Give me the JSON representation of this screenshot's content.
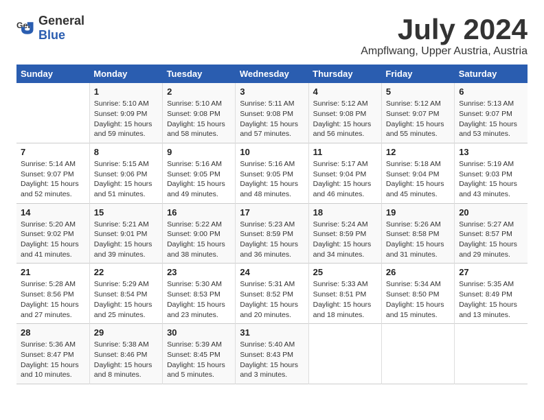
{
  "logo": {
    "general": "General",
    "blue": "Blue"
  },
  "title": "July 2024",
  "subtitle": "Ampflwang, Upper Austria, Austria",
  "weekdays": [
    "Sunday",
    "Monday",
    "Tuesday",
    "Wednesday",
    "Thursday",
    "Friday",
    "Saturday"
  ],
  "weeks": [
    [
      {
        "day": "",
        "info": ""
      },
      {
        "day": "1",
        "info": "Sunrise: 5:10 AM\nSunset: 9:09 PM\nDaylight: 15 hours\nand 59 minutes."
      },
      {
        "day": "2",
        "info": "Sunrise: 5:10 AM\nSunset: 9:08 PM\nDaylight: 15 hours\nand 58 minutes."
      },
      {
        "day": "3",
        "info": "Sunrise: 5:11 AM\nSunset: 9:08 PM\nDaylight: 15 hours\nand 57 minutes."
      },
      {
        "day": "4",
        "info": "Sunrise: 5:12 AM\nSunset: 9:08 PM\nDaylight: 15 hours\nand 56 minutes."
      },
      {
        "day": "5",
        "info": "Sunrise: 5:12 AM\nSunset: 9:07 PM\nDaylight: 15 hours\nand 55 minutes."
      },
      {
        "day": "6",
        "info": "Sunrise: 5:13 AM\nSunset: 9:07 PM\nDaylight: 15 hours\nand 53 minutes."
      }
    ],
    [
      {
        "day": "7",
        "info": "Sunrise: 5:14 AM\nSunset: 9:07 PM\nDaylight: 15 hours\nand 52 minutes."
      },
      {
        "day": "8",
        "info": "Sunrise: 5:15 AM\nSunset: 9:06 PM\nDaylight: 15 hours\nand 51 minutes."
      },
      {
        "day": "9",
        "info": "Sunrise: 5:16 AM\nSunset: 9:05 PM\nDaylight: 15 hours\nand 49 minutes."
      },
      {
        "day": "10",
        "info": "Sunrise: 5:16 AM\nSunset: 9:05 PM\nDaylight: 15 hours\nand 48 minutes."
      },
      {
        "day": "11",
        "info": "Sunrise: 5:17 AM\nSunset: 9:04 PM\nDaylight: 15 hours\nand 46 minutes."
      },
      {
        "day": "12",
        "info": "Sunrise: 5:18 AM\nSunset: 9:04 PM\nDaylight: 15 hours\nand 45 minutes."
      },
      {
        "day": "13",
        "info": "Sunrise: 5:19 AM\nSunset: 9:03 PM\nDaylight: 15 hours\nand 43 minutes."
      }
    ],
    [
      {
        "day": "14",
        "info": "Sunrise: 5:20 AM\nSunset: 9:02 PM\nDaylight: 15 hours\nand 41 minutes."
      },
      {
        "day": "15",
        "info": "Sunrise: 5:21 AM\nSunset: 9:01 PM\nDaylight: 15 hours\nand 39 minutes."
      },
      {
        "day": "16",
        "info": "Sunrise: 5:22 AM\nSunset: 9:00 PM\nDaylight: 15 hours\nand 38 minutes."
      },
      {
        "day": "17",
        "info": "Sunrise: 5:23 AM\nSunset: 8:59 PM\nDaylight: 15 hours\nand 36 minutes."
      },
      {
        "day": "18",
        "info": "Sunrise: 5:24 AM\nSunset: 8:59 PM\nDaylight: 15 hours\nand 34 minutes."
      },
      {
        "day": "19",
        "info": "Sunrise: 5:26 AM\nSunset: 8:58 PM\nDaylight: 15 hours\nand 31 minutes."
      },
      {
        "day": "20",
        "info": "Sunrise: 5:27 AM\nSunset: 8:57 PM\nDaylight: 15 hours\nand 29 minutes."
      }
    ],
    [
      {
        "day": "21",
        "info": "Sunrise: 5:28 AM\nSunset: 8:56 PM\nDaylight: 15 hours\nand 27 minutes."
      },
      {
        "day": "22",
        "info": "Sunrise: 5:29 AM\nSunset: 8:54 PM\nDaylight: 15 hours\nand 25 minutes."
      },
      {
        "day": "23",
        "info": "Sunrise: 5:30 AM\nSunset: 8:53 PM\nDaylight: 15 hours\nand 23 minutes."
      },
      {
        "day": "24",
        "info": "Sunrise: 5:31 AM\nSunset: 8:52 PM\nDaylight: 15 hours\nand 20 minutes."
      },
      {
        "day": "25",
        "info": "Sunrise: 5:33 AM\nSunset: 8:51 PM\nDaylight: 15 hours\nand 18 minutes."
      },
      {
        "day": "26",
        "info": "Sunrise: 5:34 AM\nSunset: 8:50 PM\nDaylight: 15 hours\nand 15 minutes."
      },
      {
        "day": "27",
        "info": "Sunrise: 5:35 AM\nSunset: 8:49 PM\nDaylight: 15 hours\nand 13 minutes."
      }
    ],
    [
      {
        "day": "28",
        "info": "Sunrise: 5:36 AM\nSunset: 8:47 PM\nDaylight: 15 hours\nand 10 minutes."
      },
      {
        "day": "29",
        "info": "Sunrise: 5:38 AM\nSunset: 8:46 PM\nDaylight: 15 hours\nand 8 minutes."
      },
      {
        "day": "30",
        "info": "Sunrise: 5:39 AM\nSunset: 8:45 PM\nDaylight: 15 hours\nand 5 minutes."
      },
      {
        "day": "31",
        "info": "Sunrise: 5:40 AM\nSunset: 8:43 PM\nDaylight: 15 hours\nand 3 minutes."
      },
      {
        "day": "",
        "info": ""
      },
      {
        "day": "",
        "info": ""
      },
      {
        "day": "",
        "info": ""
      }
    ]
  ]
}
